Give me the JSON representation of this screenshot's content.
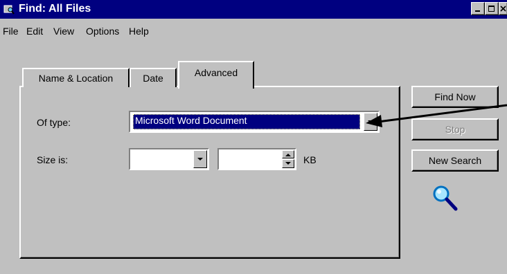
{
  "window": {
    "title": "Find: All Files"
  },
  "menu": [
    "File",
    "Edit",
    "View",
    "Options",
    "Help"
  ],
  "tabs": [
    "Name & Location",
    "Date",
    "Advanced"
  ],
  "active_tab": "Advanced",
  "fields": {
    "of_type_label": "Of type:",
    "of_type_value": "Microsoft Word Document",
    "size_label": "Size is:",
    "size_mode_value": "",
    "size_amount_value": "",
    "size_unit": "KB"
  },
  "buttons": {
    "find_now": "Find Now",
    "stop": "Stop",
    "new_search": "New Search"
  },
  "icons": [
    "find-window-icon",
    "minimize-icon",
    "maximize-icon",
    "close-icon",
    "magnifier-icon",
    "annotation-arrow"
  ],
  "colors": {
    "title_bar": "#000080",
    "face": "#c0c0c0",
    "selection": "#000080"
  }
}
